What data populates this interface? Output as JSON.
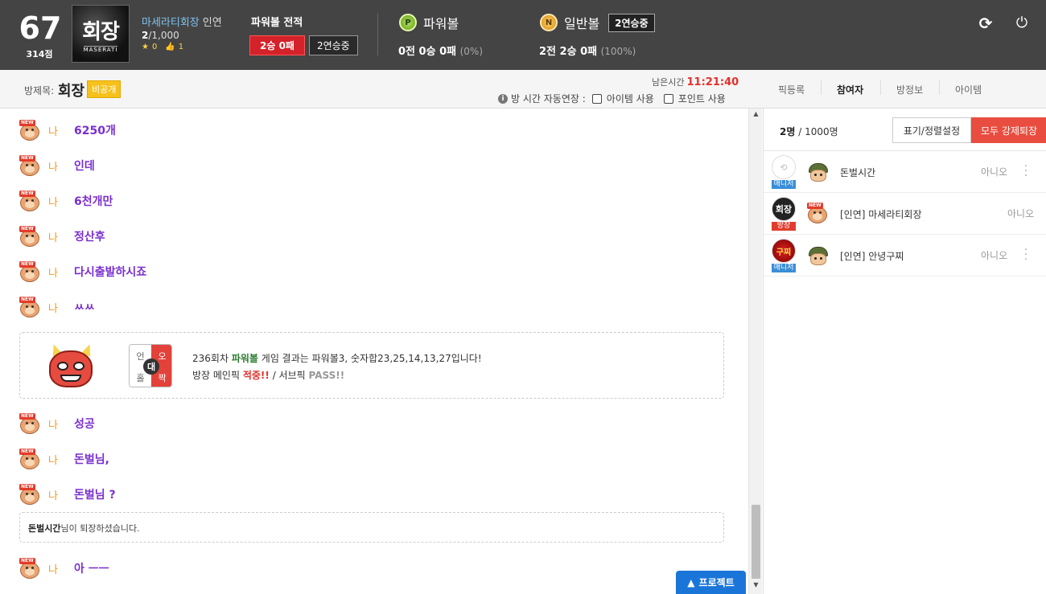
{
  "header": {
    "score": "67",
    "score_sub": "314점",
    "room_logo_text": "회장",
    "room_logo_sub": "MASERATI",
    "user_name": "마세라티회장",
    "user_grade": "인연",
    "user_count_current": "2",
    "user_count_total": "/1,000",
    "user_stars": "0",
    "user_likes": "1",
    "record_title": "파워볼 전적",
    "record_win_loss": "2승 0패",
    "record_streak": "2연승중",
    "powerball_label": "파워볼",
    "powerball_coin": "P",
    "powerball_record_bold": "0전 0승 0패",
    "powerball_pct": "(0%)",
    "normal_label": "일반볼",
    "normal_coin": "N",
    "normal_streak": "2연승중",
    "normal_record_bold": "2전 2승 0패",
    "normal_pct": "(100%)"
  },
  "room": {
    "label": "방제목:",
    "name": "회장",
    "private_badge": "비공개",
    "remaining_label": "남은시간",
    "remaining_time": "11:21:40",
    "auto_extend_label": "방 시간 자동연장 :",
    "item_use": "아이템 사용",
    "point_use": "포인트 사용"
  },
  "tabs": [
    "픽등록",
    "참여자",
    "방정보",
    "아이템"
  ],
  "chat": {
    "me_label": "나",
    "new_badge": "NEW",
    "messages": [
      "6250개",
      "인데",
      "6천개만",
      "정산후",
      "다시출발하시죠",
      "ㅆㅆ",
      "성공",
      "돈벌님,",
      "돈벌님 ?",
      "아 ㅡㅡ"
    ],
    "result": {
      "grid_tl": "언",
      "grid_tr": "오",
      "grid_bl": "홀",
      "grid_br": "짝",
      "grid_mid": "대",
      "line1_pre": "236회차",
      "line1_game": "파워볼",
      "line1_post": "게임 결과는 파워볼3, 숫자합23,25,14,13,27입니다!",
      "line2_pre": "방장 메인픽",
      "line2_hit": "적중!!",
      "line2_mid": "/ 서브픽",
      "line2_pass": "PASS!!"
    },
    "system_name": "돈벌시간",
    "system_text": "님이 퇴장하셨습니다."
  },
  "project_button": "프로젝트",
  "participants": {
    "count": "2명",
    "total": "/ 1000명",
    "settings_button": "표기/정렬설정",
    "kick_all_button": "모두 강제퇴장",
    "list": [
      {
        "name": "돈벌시간",
        "role": "매니저",
        "status": "아니오",
        "avatar": ""
      },
      {
        "name": "[인연] 마세라티회장",
        "role": "방장",
        "status": "아니오",
        "avatar": "회장"
      },
      {
        "name": "[인연] 안녕구찌",
        "role": "매니저",
        "status": "아니오",
        "avatar": "구찌"
      }
    ]
  },
  "colors": {
    "header_bg": "#444444",
    "accent_red": "#e94d3f",
    "chat_purple": "#7a2fd0",
    "me_orange": "#f09a1a",
    "blue_button": "#1a75d8"
  }
}
